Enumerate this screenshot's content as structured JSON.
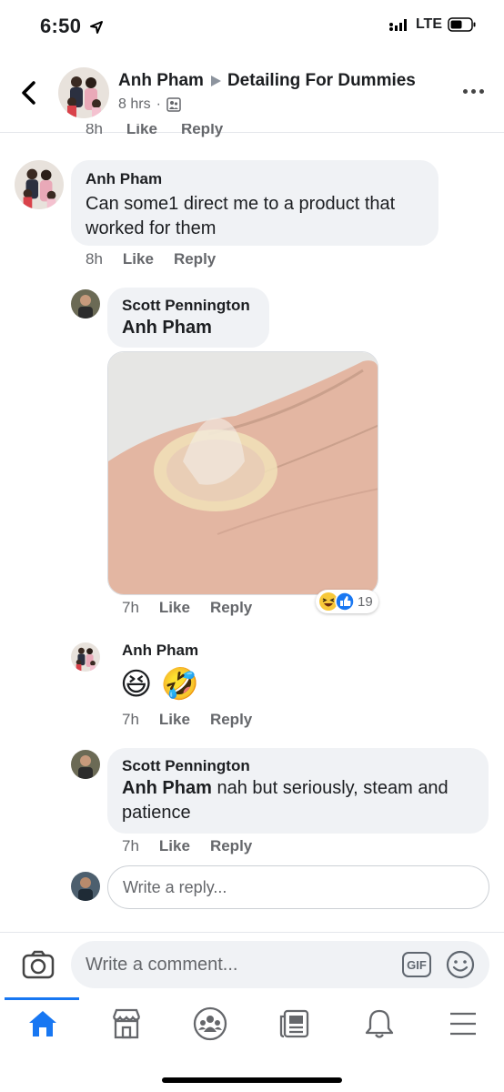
{
  "status": {
    "time": "6:50",
    "network": "LTE"
  },
  "header": {
    "author": "Anh Pham",
    "group": "Detailing For Dummies",
    "time": "8 hrs"
  },
  "cut_actions": {
    "time": "8h",
    "like": "Like",
    "reply": "Reply"
  },
  "comments": [
    {
      "author": "Anh Pham",
      "text": "Can some1 direct me to a product that worked for them",
      "time": "8h",
      "like": "Like",
      "reply": "Reply"
    },
    {
      "author": "Scott Pennington",
      "mention": "Anh Pham",
      "time": "7h",
      "like": "Like",
      "reply": "Reply",
      "reaction_count": "19"
    },
    {
      "author": "Anh Pham",
      "emojis": "😆 🤣",
      "time": "7h",
      "like": "Like",
      "reply": "Reply"
    },
    {
      "author": "Scott Pennington",
      "mention": "Anh Pham",
      "text": " nah but seriously, steam and patience",
      "time": "7h",
      "like": "Like",
      "reply": "Reply"
    }
  ],
  "reply_box": {
    "placeholder": "Write a reply..."
  },
  "composer": {
    "placeholder": "Write a comment...",
    "gif": "GIF"
  },
  "nav": {
    "items": [
      "home-icon",
      "marketplace-icon",
      "groups-icon",
      "news-icon",
      "bell-icon",
      "menu-icon"
    ],
    "active": 0
  },
  "colors": {
    "accent": "#1877f2",
    "bubble": "#f0f2f5",
    "secondary_text": "#65676b"
  }
}
